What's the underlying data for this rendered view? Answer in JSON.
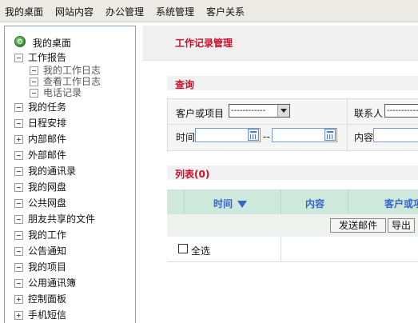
{
  "top_menu": [
    "我的桌面",
    "网站内容",
    "办公管理",
    "系统管理",
    "客户关系"
  ],
  "sidebar": {
    "items": [
      {
        "label": "我的桌面",
        "icon": "home-search-icon"
      },
      {
        "label": "工作报告",
        "icon": "minus-box-icon"
      },
      {
        "label": "我的工作日志",
        "icon": "minus-box-icon",
        "sub": true
      },
      {
        "label": "查看工作日志",
        "icon": "minus-box-icon",
        "sub": true
      },
      {
        "label": "电话记录",
        "icon": "minus-box-icon",
        "sub": true
      },
      {
        "label": "我的任务",
        "icon": "minus-box-icon"
      },
      {
        "label": "日程安排",
        "icon": "minus-box-icon"
      },
      {
        "label": "内部邮件",
        "icon": "plus-box-icon"
      },
      {
        "label": "外部邮件",
        "icon": "minus-box-icon"
      },
      {
        "label": "我的通讯录",
        "icon": "minus-box-icon"
      },
      {
        "label": "我的网盘",
        "icon": "minus-box-icon"
      },
      {
        "label": "公共网盘",
        "icon": "minus-box-icon"
      },
      {
        "label": "朋友共享的文件",
        "icon": "minus-box-icon"
      },
      {
        "label": "我的工作",
        "icon": "minus-box-icon"
      },
      {
        "label": "公告通知",
        "icon": "minus-box-icon"
      },
      {
        "label": "我的项目",
        "icon": "minus-box-icon"
      },
      {
        "label": "公用通讯簿",
        "icon": "minus-box-icon"
      },
      {
        "label": "控制面板",
        "icon": "plus-box-icon"
      },
      {
        "label": "手机短信",
        "icon": "plus-box-icon"
      }
    ]
  },
  "main": {
    "title": "工作记录管理",
    "query": {
      "heading": "查询",
      "customer_label": "客户或项目",
      "customer_value": "------------",
      "contact_label": "联系人",
      "contact_value": "------------",
      "time_label": "时间",
      "time_sep": "--",
      "content_label": "内容"
    },
    "list": {
      "heading": "列表(0)",
      "columns": [
        "时间",
        "内容",
        "客户或项"
      ],
      "sort_icon": "sort-desc-icon",
      "send_button": "发送邮件",
      "export_button": "导出",
      "select_all": "全选"
    }
  },
  "colors": {
    "accent_red": "#c8102e",
    "header_blue": "#3466c8",
    "list_head_bg": "#cfe8dc"
  }
}
